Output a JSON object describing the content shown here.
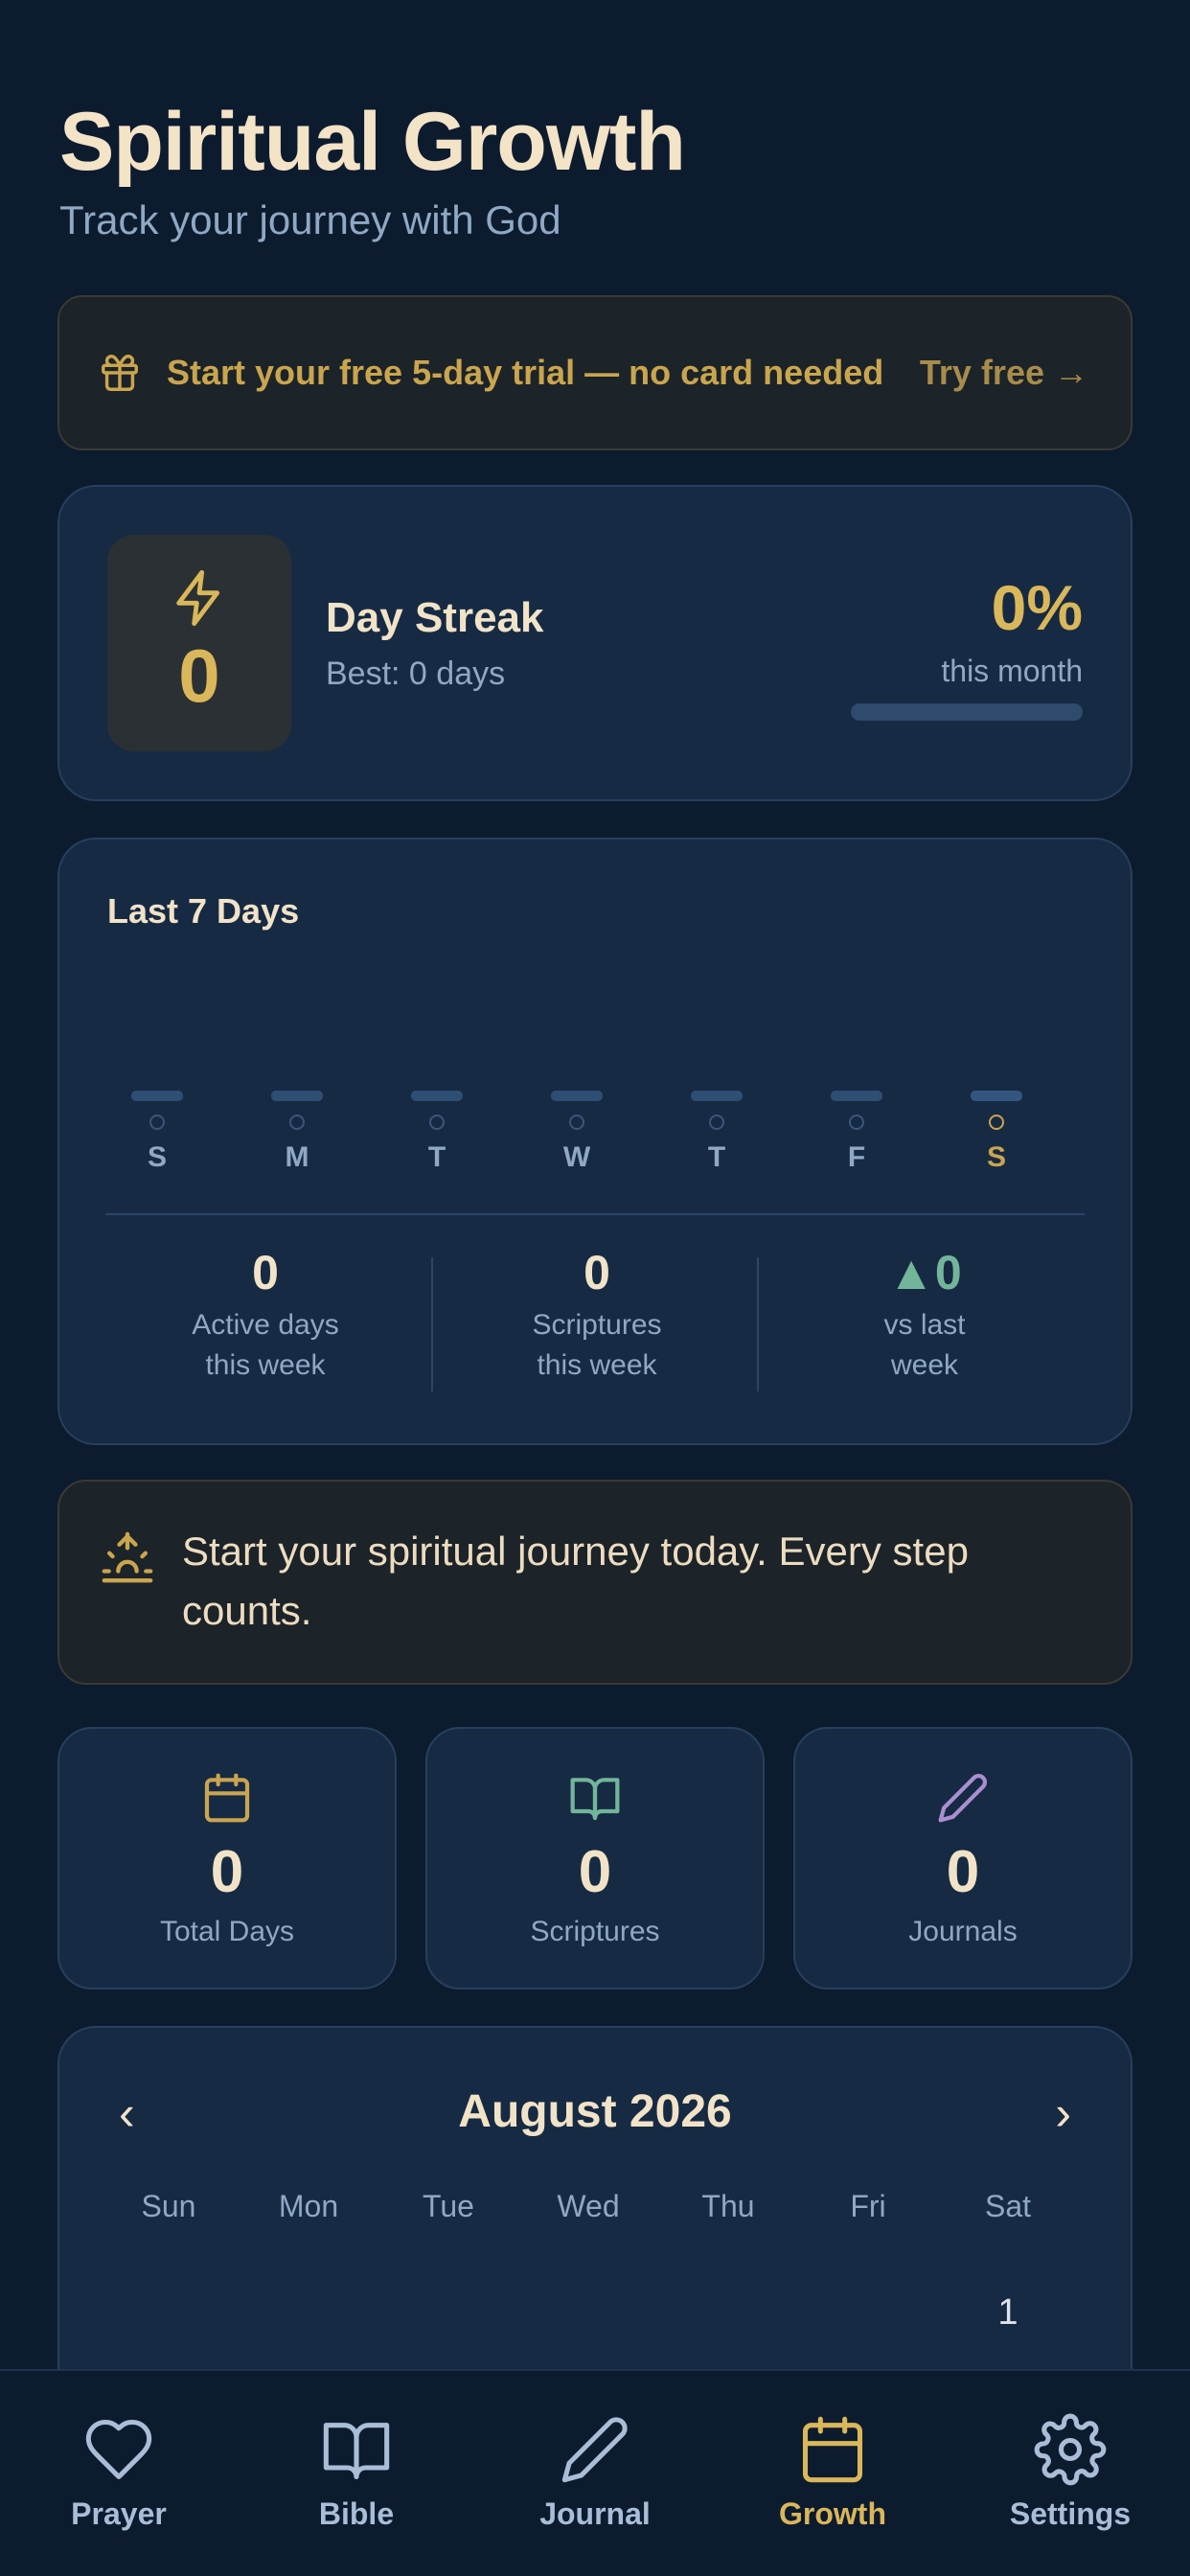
{
  "header": {
    "title": "Spiritual Growth",
    "subtitle": "Track your journey with God"
  },
  "trial_banner": {
    "icon": "gift-icon",
    "message": "Start your free 5-day trial — no card needed",
    "action_label": "Try free →"
  },
  "streak": {
    "icon": "lightning-icon",
    "count": "0",
    "title": "Day Streak",
    "best": "Best: 0 days",
    "percent": "0%",
    "percent_label": "this month",
    "progress_fraction": 0
  },
  "last7": {
    "title": "Last 7 Days",
    "days": [
      "S",
      "M",
      "T",
      "W",
      "T",
      "F",
      "S"
    ],
    "today_index": 6,
    "stats": [
      {
        "value": "0",
        "caption_line1": "Active days",
        "caption_line2": "this week"
      },
      {
        "value": "0",
        "caption_line1": "Scriptures",
        "caption_line2": "this week"
      },
      {
        "value": "0",
        "caption_line1": "vs last",
        "caption_line2": "week",
        "trend": "up",
        "trend_glyph": "▲"
      }
    ]
  },
  "encouragement": {
    "icon": "sunrise-icon",
    "text": "Start your spiritual journey today. Every step counts."
  },
  "summary": [
    {
      "icon": "calendar-icon",
      "value": "0",
      "label": "Total Days",
      "color": "#c9a54e"
    },
    {
      "icon": "book-icon",
      "value": "0",
      "label": "Scriptures",
      "color": "#73b59a"
    },
    {
      "icon": "pencil-icon",
      "value": "0",
      "label": "Journals",
      "color": "#a98fd0"
    }
  ],
  "calendar": {
    "month_label": "August 2026",
    "prev_glyph": "‹",
    "next_glyph": "›",
    "weekdays": [
      "Sun",
      "Mon",
      "Tue",
      "Wed",
      "Thu",
      "Fri",
      "Sat"
    ],
    "visible_dates": [
      "1"
    ]
  },
  "tabbar": {
    "active": "growth",
    "tabs": [
      {
        "id": "prayer",
        "label": "Prayer",
        "icon": "heart-icon"
      },
      {
        "id": "bible",
        "label": "Bible",
        "icon": "book-icon"
      },
      {
        "id": "journal",
        "label": "Journal",
        "icon": "pencil-icon"
      },
      {
        "id": "growth",
        "label": "Growth",
        "icon": "calendar-icon"
      },
      {
        "id": "settings",
        "label": "Settings",
        "icon": "gear-icon"
      }
    ]
  },
  "colors": {
    "background": "#0d1b2f",
    "card": "#172a44",
    "accent_gold": "#d9b75a",
    "accent_green": "#73b59a",
    "muted_text": "#8fa8c3"
  }
}
